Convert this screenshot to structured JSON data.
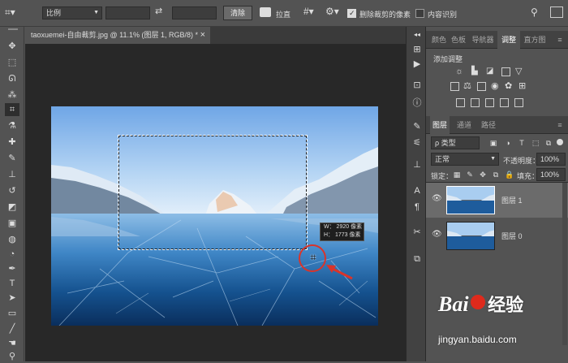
{
  "options_bar": {
    "ratio_label": "比例",
    "clear_label": "清除",
    "straighten_label": "拉直",
    "delete_cropped_label": "删除裁剪的像素",
    "delete_cropped_checked": true,
    "content_aware_label": "内容识别",
    "content_aware_checked": false
  },
  "document": {
    "tab_title": "taoxuemei-自由裁剪.jpg @ 11.1% (图层 1, RGB/8) *",
    "close_glyph": "×"
  },
  "crop_tooltip": {
    "width": "W： 2920 像素",
    "height": "H： 1773 像素"
  },
  "panels": {
    "top_tabs": [
      "颜色",
      "色板",
      "导航器",
      "调整",
      "直方图"
    ],
    "active_top_tab": "调整",
    "adjust_title": "添加调整",
    "layer_tabs": [
      "图层",
      "通道",
      "路径"
    ],
    "active_layer_tab": "图层",
    "filter_kind": "ρ 类型",
    "blend_mode": "正常",
    "opacity_label": "不透明度：",
    "opacity_value": "100%",
    "lock_label": "锁定：",
    "fill_label": "填充：",
    "fill_value": "100%",
    "layers": [
      {
        "name": "图层 1",
        "selected": true
      },
      {
        "name": "图层 0",
        "selected": false
      }
    ]
  },
  "watermark": {
    "brand_left": "Bai",
    "brand_right": "经验",
    "url": "jingyan.baidu.com"
  },
  "colors": {
    "ui_bg": "#535353",
    "canvas_bg": "#282828",
    "accent_red": "#d9342b",
    "baidu_red": "#de2a1c"
  }
}
